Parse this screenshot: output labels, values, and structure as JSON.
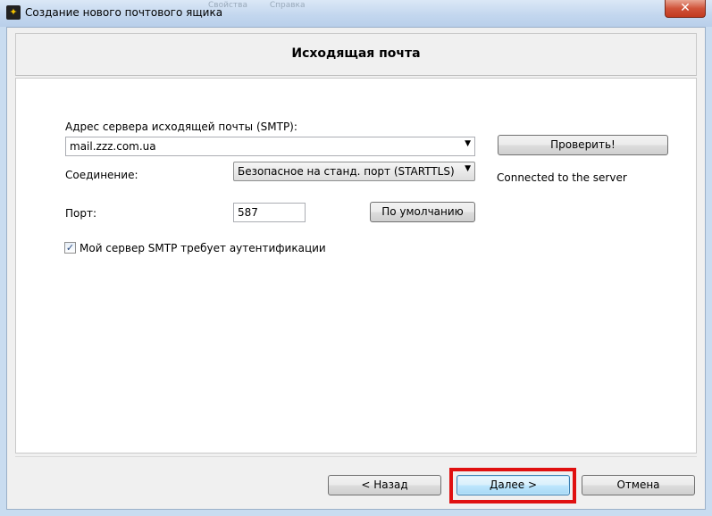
{
  "window": {
    "title": "Создание нового почтового ящика",
    "ghost_menu": [
      "Свойства",
      "Справка"
    ],
    "close_glyph": "✕"
  },
  "header": {
    "title": "Исходящая почта"
  },
  "form": {
    "smtp_label": "Адрес сервера исходящей почты (SMTP):",
    "smtp_value": "mail.zzz.com.ua",
    "connection_label": "Соединение:",
    "connection_value": "Безопасное на станд. порт (STARTTLS)",
    "port_label": "Порт:",
    "port_value": "587",
    "default_button": "По умолчанию",
    "check_button": "Проверить!",
    "status_text": "Connected to the server",
    "auth_checkbox_label": "Мой сервер SMTP требует аутентификации",
    "auth_checked": true
  },
  "footer": {
    "back_button": "<  Назад",
    "next_button": "Далее  >",
    "cancel_button": "Отмена"
  },
  "icons": {
    "app": "mail-bat-icon",
    "dropdown": "chevron-down-icon",
    "close": "close-icon"
  },
  "colors": {
    "highlight": "#e01010",
    "focus_button": "#3c7fb1"
  }
}
